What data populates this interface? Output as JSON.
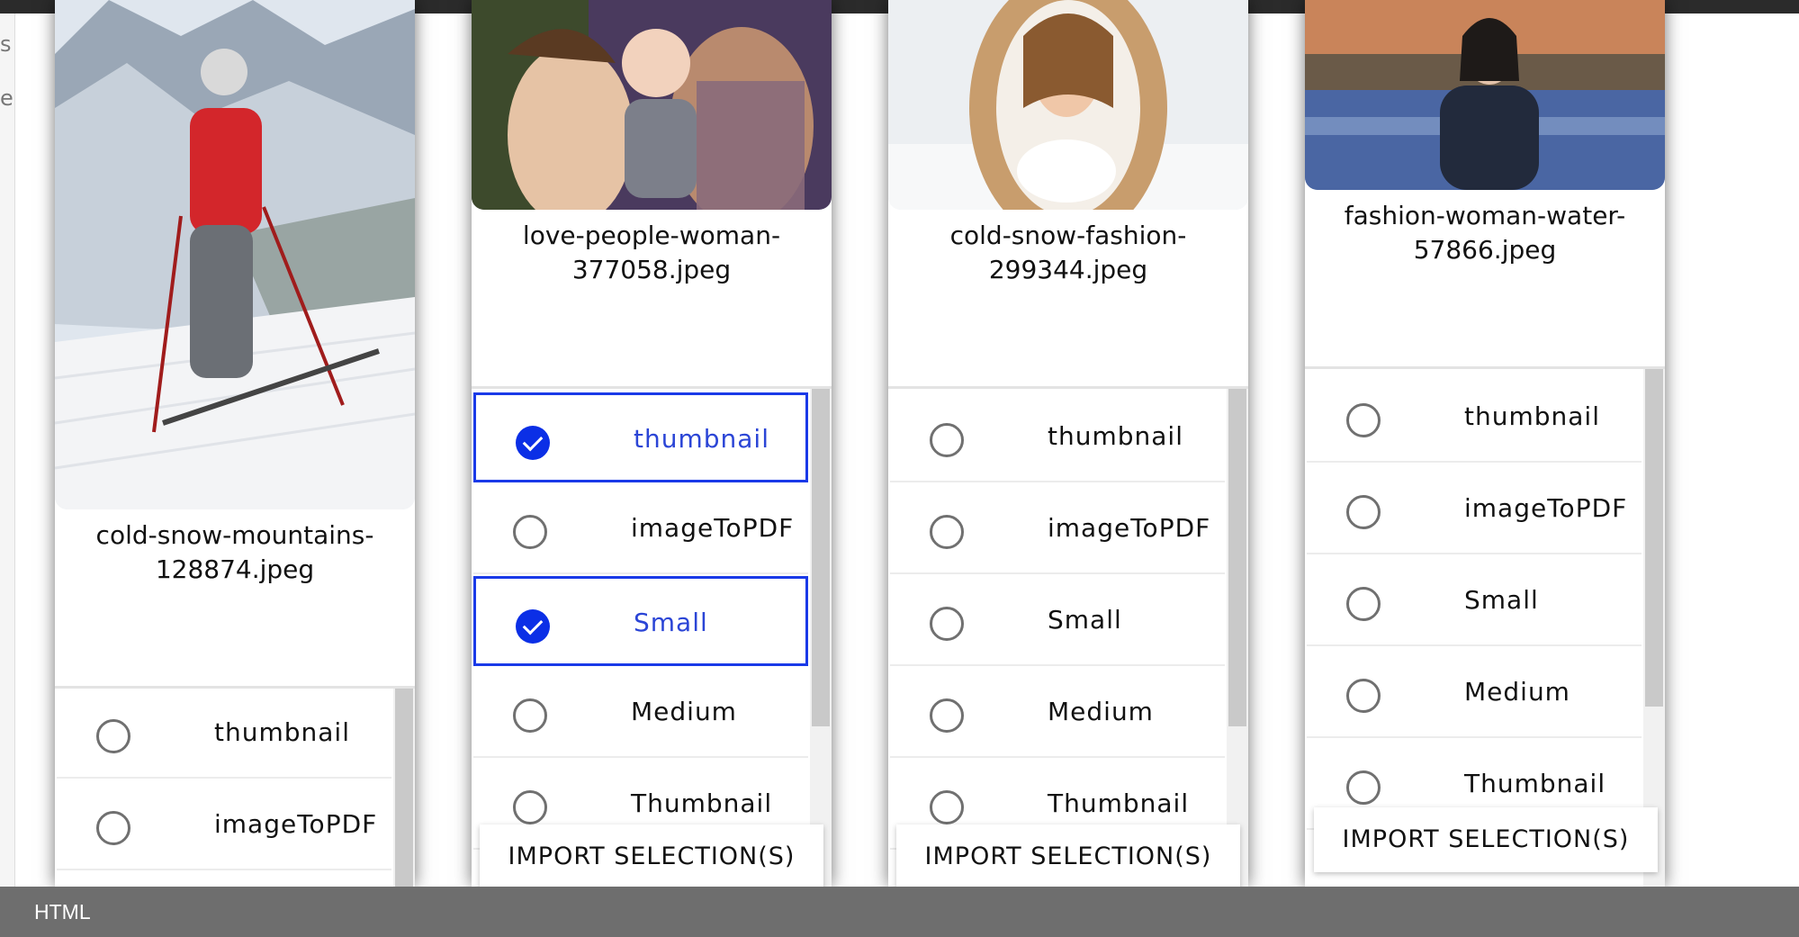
{
  "left_edge": {
    "fragments": [
      "s",
      "e"
    ]
  },
  "bottom_bar": {
    "label": "HTML"
  },
  "cards": [
    {
      "filename": "cold-snow-mountains-128874.jpeg",
      "options": [
        {
          "label": "thumbnail",
          "selected": false
        },
        {
          "label": "imageToPDF",
          "selected": false
        }
      ]
    },
    {
      "filename": "love-people-woman-377058.jpeg",
      "options": [
        {
          "label": "thumbnail",
          "selected": true
        },
        {
          "label": "imageToPDF",
          "selected": false
        },
        {
          "label": "Small",
          "selected": true
        },
        {
          "label": "Medium",
          "selected": false
        },
        {
          "label": "Thumbnail",
          "selected": false
        }
      ],
      "import_label": "IMPORT SELECTION(S)"
    },
    {
      "filename": "cold-snow-fashion-299344.jpeg",
      "options": [
        {
          "label": "thumbnail",
          "selected": false
        },
        {
          "label": "imageToPDF",
          "selected": false
        },
        {
          "label": "Small",
          "selected": false
        },
        {
          "label": "Medium",
          "selected": false
        },
        {
          "label": "Thumbnail",
          "selected": false
        }
      ],
      "import_label": "IMPORT SELECTION(S)"
    },
    {
      "filename": "fashion-woman-water-57866.jpeg",
      "options": [
        {
          "label": "thumbnail",
          "selected": false
        },
        {
          "label": "imageToPDF",
          "selected": false
        },
        {
          "label": "Small",
          "selected": false
        },
        {
          "label": "Medium",
          "selected": false
        },
        {
          "label": "Thumbnail",
          "selected": false
        }
      ],
      "import_label": "IMPORT SELECTION(S)"
    }
  ],
  "colors": {
    "accent": "#0b2fe6",
    "selected_text": "#2b45d6",
    "radio_border": "#707070"
  }
}
